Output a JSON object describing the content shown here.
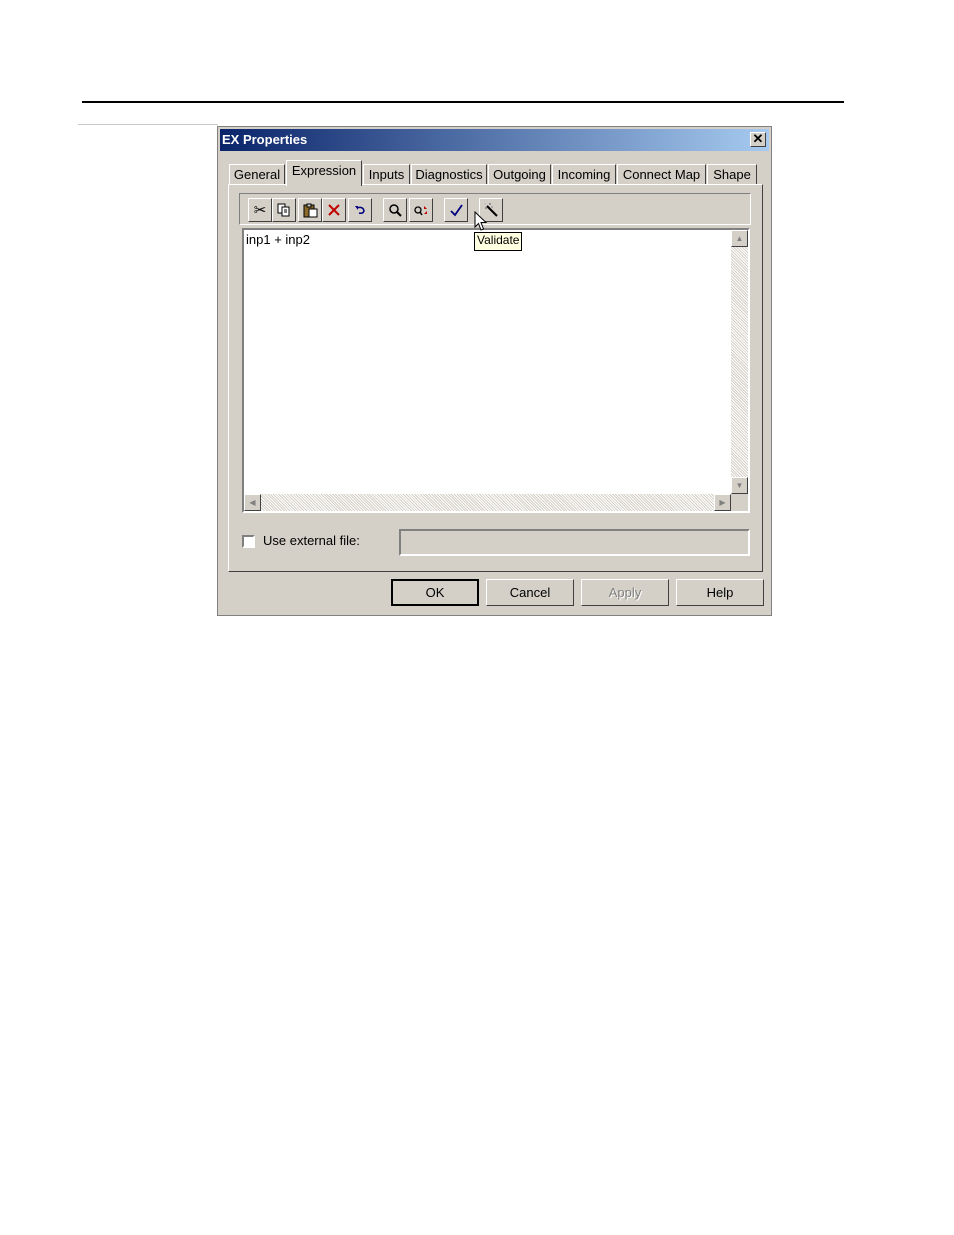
{
  "dialog": {
    "title": "EX Properties",
    "close_glyph": "✕"
  },
  "tabs": [
    "General",
    "Expression",
    "Inputs",
    "Diagnostics",
    "Outgoing",
    "Incoming",
    "Connect Map",
    "Shape"
  ],
  "active_tab": "Expression",
  "toolbar": {
    "icons": [
      "cut-icon",
      "copy-icon",
      "paste-icon",
      "delete-icon",
      "undo-icon",
      "find-icon",
      "replace-icon",
      "validate-icon",
      "wizard-icon"
    ]
  },
  "tooltip": {
    "text": "Validate"
  },
  "editor": {
    "content": "inp1 + inp2"
  },
  "external_file": {
    "label": "Use external file:",
    "value": "",
    "checked": false
  },
  "buttons": {
    "ok": "OK",
    "cancel": "Cancel",
    "apply": "Apply",
    "help": "Help"
  }
}
